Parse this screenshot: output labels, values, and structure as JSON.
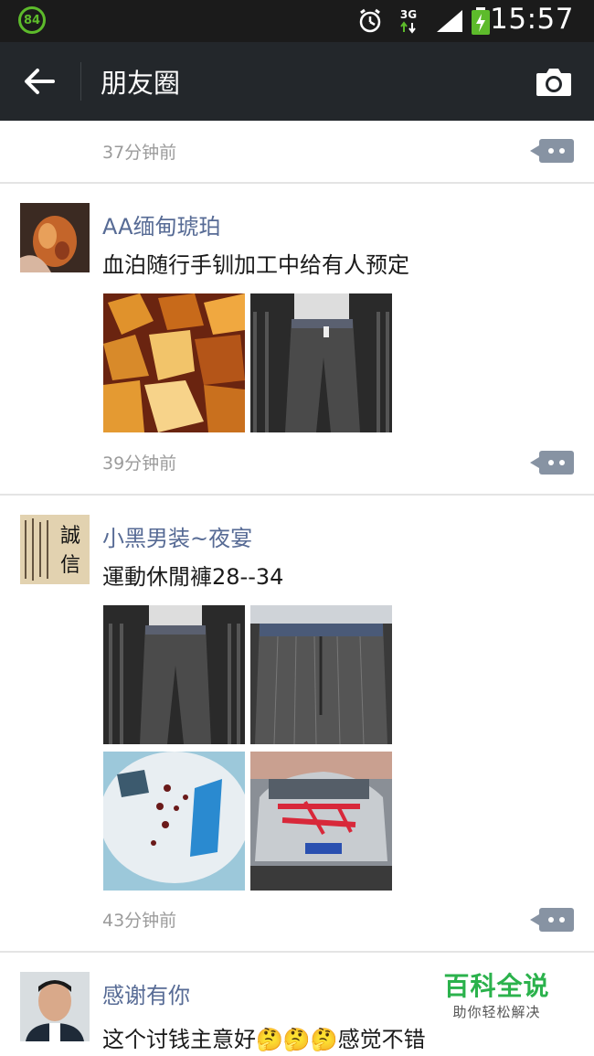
{
  "statusbar": {
    "battery_level": "84",
    "network": "3G",
    "time": "15:57"
  },
  "navbar": {
    "title": "朋友圈",
    "back_icon": "arrow-left-icon",
    "camera_icon": "camera-icon"
  },
  "feed": {
    "partial_post": {
      "timestamp": "37分钟前"
    },
    "posts": [
      {
        "name": "AA缅甸琥珀",
        "content": "血泊随行手钏加工中给有人预定",
        "timestamp": "39分钟前",
        "images": [
          "amber-stones-image",
          "pants-rack-image"
        ]
      },
      {
        "name": "小黑男装~夜宴",
        "content": "運動休閒褲28--34",
        "timestamp": "43分钟前",
        "avatar_text": "誠信",
        "images": [
          "pants-front-image",
          "pants-closeup-image",
          "bowl-blue-paper-image",
          "car-graffiti-image"
        ]
      },
      {
        "name": "感谢有你",
        "content": "这个讨钱主意好🤔🤔🤔感觉不错"
      }
    ]
  },
  "watermark": {
    "title": "百科全说",
    "subtitle": "助你轻松解决"
  },
  "colors": {
    "name_link": "#576b95",
    "navbar_bg": "#23272b",
    "statusbar_bg": "#1b1b1b",
    "comment_button": "#8793a3",
    "watermark_green": "#2bb24c"
  }
}
